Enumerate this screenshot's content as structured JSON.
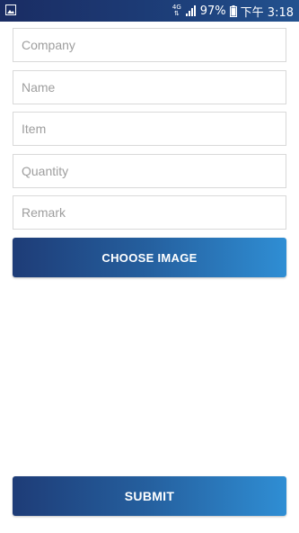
{
  "status_bar": {
    "network": "4G",
    "battery": "97%",
    "time": "下午 3:18"
  },
  "form": {
    "company_placeholder": "Company",
    "name_placeholder": "Name",
    "item_placeholder": "Item",
    "quantity_placeholder": "Quantity",
    "remark_placeholder": "Remark"
  },
  "buttons": {
    "choose_image": "CHOOSE IMAGE",
    "submit": "SUBMIT"
  },
  "colors": {
    "status_bar": "#1d3f7a",
    "button_start": "#1e3c77",
    "button_end": "#2f8ed4"
  }
}
